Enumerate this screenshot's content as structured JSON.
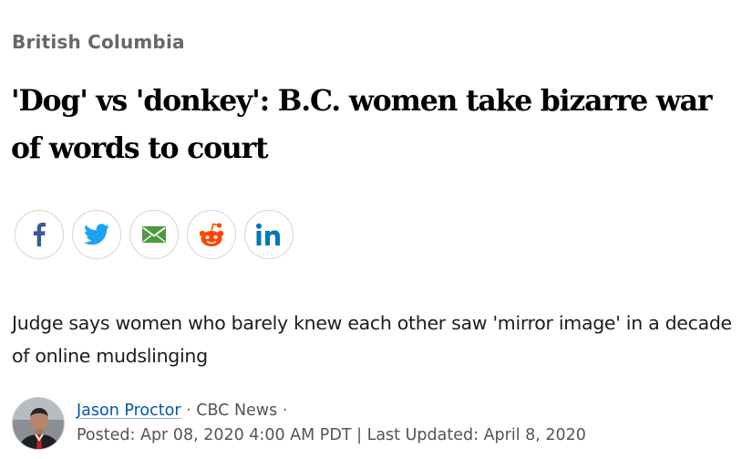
{
  "section": {
    "label": "British Columbia"
  },
  "headline": {
    "text": "'Dog' vs 'donkey': B.C. women take bizarre war of words to court"
  },
  "share": [
    {
      "name": "facebook",
      "icon": "facebook-icon",
      "color": "#3b5998"
    },
    {
      "name": "twitter",
      "icon": "twitter-icon",
      "color": "#1da1f2"
    },
    {
      "name": "email",
      "icon": "email-icon",
      "color": "#4c9b3f"
    },
    {
      "name": "reddit",
      "icon": "reddit-icon",
      "color": "#ff4500"
    },
    {
      "name": "linkedin",
      "icon": "linkedin-icon",
      "color": "#0077b5"
    }
  ],
  "deck": {
    "text": "Judge says women who barely knew each other saw 'mirror image' in a decade of online mudslinging"
  },
  "byline": {
    "author": "Jason Proctor",
    "separator": "·",
    "outlet": "CBC News",
    "posted_label": "Posted:",
    "posted": "Apr 08, 2020 4:00 AM PDT",
    "divider": "|",
    "updated_label": "Last Updated:",
    "updated": "April 8, 2020"
  },
  "colors": {
    "link": "#0059a5",
    "section": "#676767",
    "text": "#1c1c1c"
  }
}
